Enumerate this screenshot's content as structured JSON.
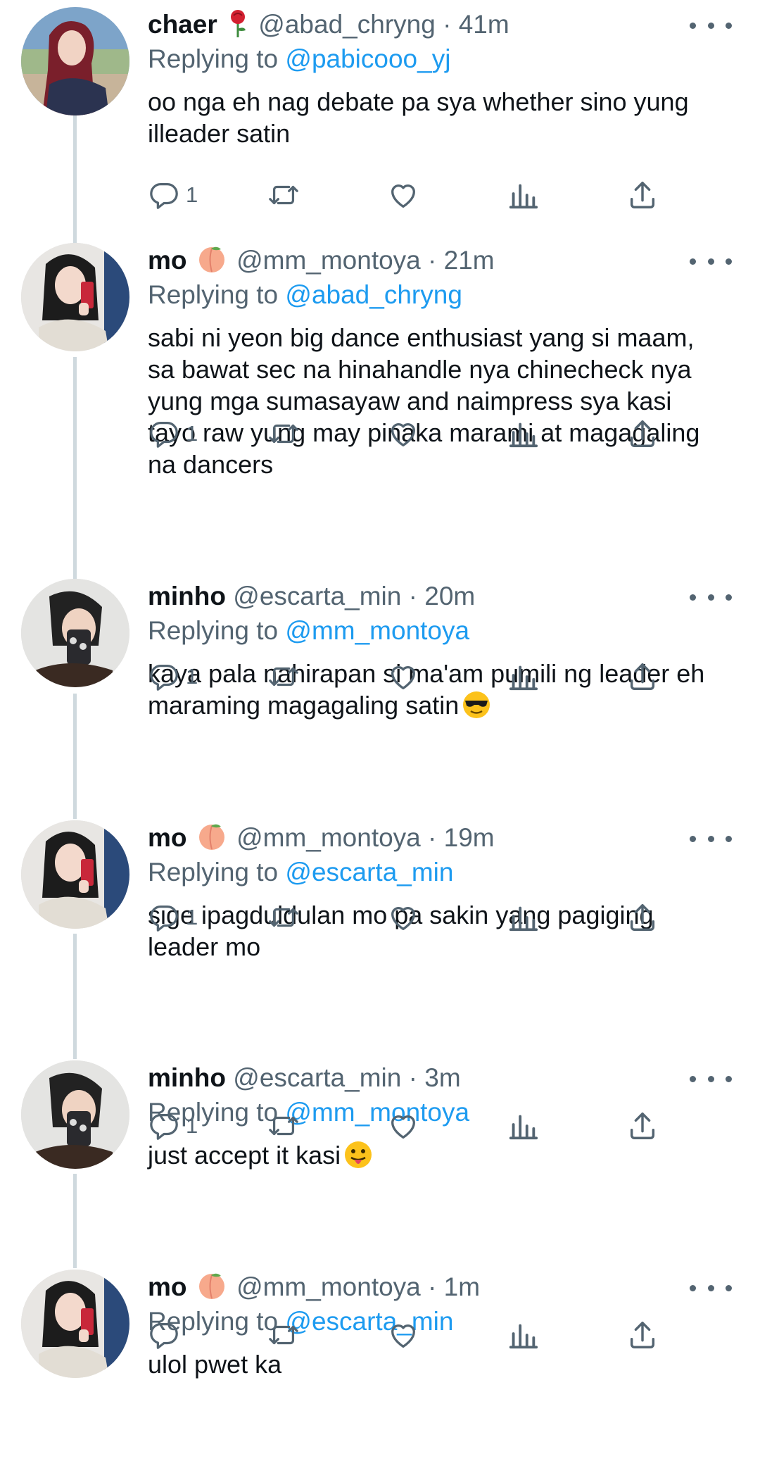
{
  "colors": {
    "accent": "#1d9bf0",
    "secondary_text": "#536471",
    "text": "#0f1419",
    "thread_line": "#cfd9de"
  },
  "tweets": [
    {
      "name": "chaer",
      "name_emoji": "rose",
      "handle": "@abad_chryng",
      "time": "41m",
      "replying_label": "Replying to",
      "replying_to": "@pabicooo_yj",
      "text": "oo nga eh nag debate pa sya whether sino yung illeader satin",
      "text_emoji": "",
      "reply_count": "1",
      "avatar": "avatar-red-hair"
    },
    {
      "name": "mo",
      "name_emoji": "peach",
      "handle": "@mm_montoya",
      "time": "21m",
      "replying_label": "Replying to",
      "replying_to": "@abad_chryng",
      "text": "sabi ni yeon big dance enthusiast yang si maam, sa bawat sec na hinahandle nya chinecheck nya yung mga sumasayaw and naimpress sya kasi tayo raw yung may pinaka marami at magagaling na dancers",
      "text_emoji": "",
      "reply_count": "1",
      "avatar": "avatar-mirror-selfie"
    },
    {
      "name": "minho",
      "name_emoji": "",
      "handle": "@escarta_min",
      "time": "20m",
      "replying_label": "Replying to",
      "replying_to": "@mm_montoya",
      "text": "kaya pala nahirapan si ma'am pumili ng leader eh maraming magagaling satin",
      "text_emoji": "sunglasses-face",
      "reply_count": "1",
      "avatar": "avatar-phone-selfie"
    },
    {
      "name": "mo",
      "name_emoji": "peach",
      "handle": "@mm_montoya",
      "time": "19m",
      "replying_label": "Replying to",
      "replying_to": "@escarta_min",
      "text": "sige ipagduldulan mo pa sakin yang pagiging leader mo",
      "text_emoji": "",
      "reply_count": "1",
      "avatar": "avatar-mirror-selfie"
    },
    {
      "name": "minho",
      "name_emoji": "",
      "handle": "@escarta_min",
      "time": "3m",
      "replying_label": "Replying to",
      "replying_to": "@mm_montoya",
      "text": "just accept it kasi",
      "text_emoji": "tongue-face",
      "reply_count": "1",
      "avatar": "avatar-phone-selfie"
    },
    {
      "name": "mo",
      "name_emoji": "peach",
      "handle": "@mm_montoya",
      "time": "1m",
      "replying_label": "Replying to",
      "replying_to": "@escarta_min",
      "text": "ulol pwet ka",
      "text_emoji": "",
      "reply_count": "",
      "avatar": "avatar-mirror-selfie"
    }
  ],
  "icons": {
    "reply": "reply-icon",
    "retweet": "retweet-icon",
    "like": "heart-icon",
    "views": "views-icon",
    "share": "share-icon",
    "more": "more-icon"
  }
}
